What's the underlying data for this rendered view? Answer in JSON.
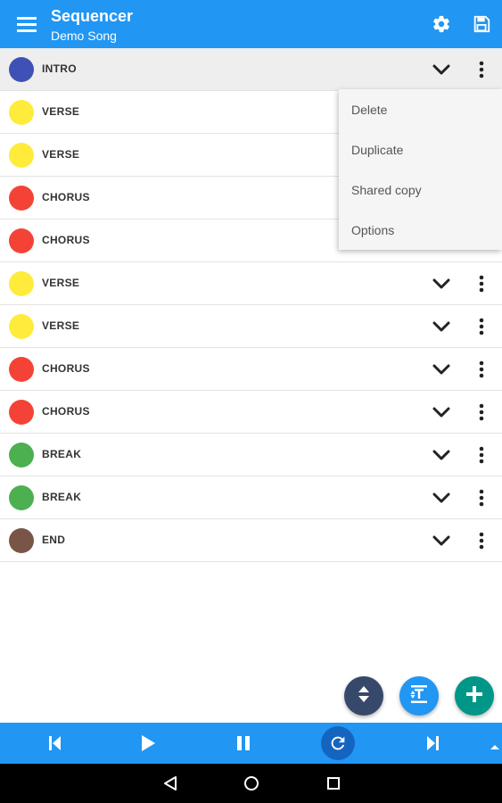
{
  "appbar": {
    "title": "Sequencer",
    "subtitle": "Demo Song",
    "background": "#2196F3",
    "menu_icon": "hamburger-menu-icon",
    "settings_icon": "gear-icon",
    "save_icon": "save-icon"
  },
  "sections": [
    {
      "label": "INTRO",
      "color": "#3F51B5",
      "selected": true
    },
    {
      "label": "VERSE",
      "color": "#FFEB3B"
    },
    {
      "label": "VERSE",
      "color": "#FFEB3B"
    },
    {
      "label": "CHORUS",
      "color": "#F44336"
    },
    {
      "label": "CHORUS",
      "color": "#F44336"
    },
    {
      "label": "VERSE",
      "color": "#FFEB3B"
    },
    {
      "label": "VERSE",
      "color": "#FFEB3B"
    },
    {
      "label": "CHORUS",
      "color": "#F44336"
    },
    {
      "label": "CHORUS",
      "color": "#F44336"
    },
    {
      "label": "BREAK",
      "color": "#4CAF50"
    },
    {
      "label": "BREAK",
      "color": "#4CAF50"
    },
    {
      "label": "END",
      "color": "#795548"
    }
  ],
  "popup_menu": {
    "items": [
      "Delete",
      "Duplicate",
      "Shared copy",
      "Options"
    ]
  },
  "fabs": [
    {
      "name": "reorder-fab",
      "icon": "sort-arrows-icon",
      "color": "#37496B"
    },
    {
      "name": "align-fab",
      "icon": "text-height-icon",
      "color": "#2196F3"
    },
    {
      "name": "add-section-fab",
      "icon": "plus-icon",
      "color": "#009688"
    }
  ],
  "transport": {
    "background": "#2196F3",
    "buttons": [
      "skip-previous-icon",
      "play-icon",
      "pause-icon",
      "repeat-icon",
      "skip-next-icon"
    ],
    "active": "repeat-icon"
  },
  "system_nav": [
    "back-icon",
    "home-icon",
    "recents-icon"
  ]
}
